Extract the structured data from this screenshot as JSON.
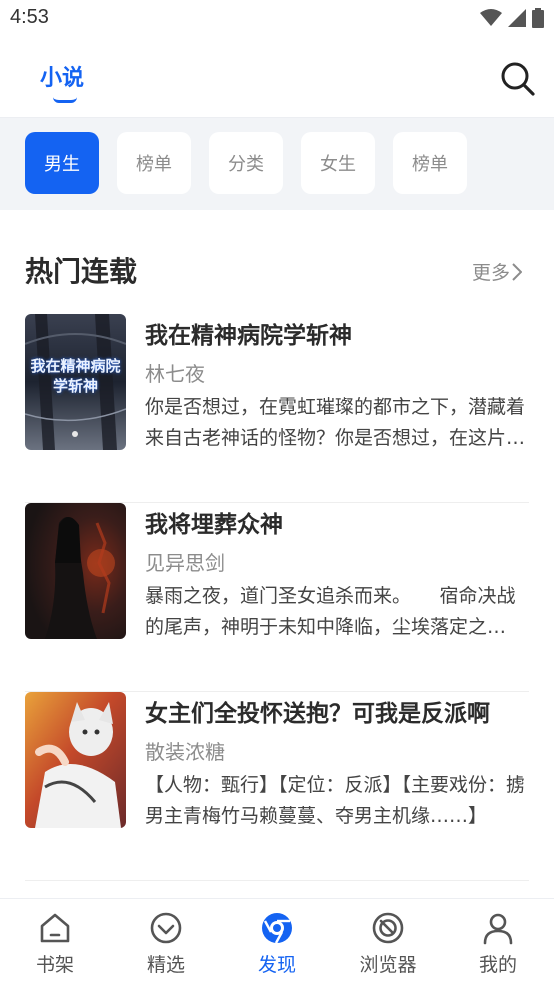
{
  "status_bar": {
    "time": "4:53"
  },
  "header": {
    "tab_label": "小说"
  },
  "chips": [
    {
      "label": "男生",
      "active": true
    },
    {
      "label": "榜单",
      "active": false
    },
    {
      "label": "分类",
      "active": false
    },
    {
      "label": "女生",
      "active": false
    },
    {
      "label": "榜单",
      "active": false
    }
  ],
  "section": {
    "title": "热门连载",
    "more_label": "更多"
  },
  "books": [
    {
      "title": "我在精神病院学斩神",
      "author": "林七夜",
      "description": "你是否想过，在霓虹璀璨的都市之下，潜藏着来自古老神话的怪物？你是否想过，在这片繁华的背后，隐藏着不为人知的秘密……",
      "cover_text": "我在精神病院学斩神"
    },
    {
      "title": "我将埋葬众神",
      "author": "见异思剑",
      "description": "暴雨之夜，道门圣女追杀而来。　　宿命决战的尾声，神明于未知中降临，尘埃落定之时……"
    },
    {
      "title": "女主们全投怀送抱？可我是反派啊",
      "author": "散装浓糖",
      "description": "【人物：甄行】【定位：反派】【主要戏份：掳男主青梅竹马赖蔓蔓、夺男主机缘……】"
    }
  ],
  "tabs": [
    {
      "label": "书架",
      "icon": "home-icon",
      "active": false
    },
    {
      "label": "精选",
      "icon": "featured-icon",
      "active": false
    },
    {
      "label": "发现",
      "icon": "discover-icon",
      "active": true
    },
    {
      "label": "浏览器",
      "icon": "browser-icon",
      "active": false
    },
    {
      "label": "我的",
      "icon": "profile-icon",
      "active": false
    }
  ],
  "colors": {
    "accent": "#1463f2",
    "chip_bg": "#f2f4f7",
    "muted": "#8c8c8c"
  }
}
